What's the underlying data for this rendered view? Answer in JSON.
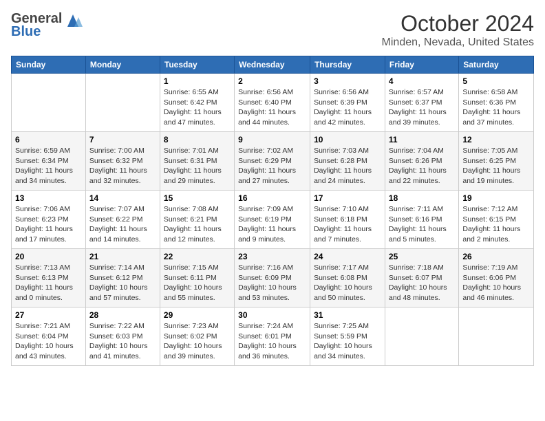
{
  "header": {
    "logo_text_general": "General",
    "logo_text_blue": "Blue",
    "title": "October 2024",
    "subtitle": "Minden, Nevada, United States"
  },
  "days_of_week": [
    "Sunday",
    "Monday",
    "Tuesday",
    "Wednesday",
    "Thursday",
    "Friday",
    "Saturday"
  ],
  "weeks": [
    [
      {
        "num": "",
        "sunrise": "",
        "sunset": "",
        "daylight": ""
      },
      {
        "num": "",
        "sunrise": "",
        "sunset": "",
        "daylight": ""
      },
      {
        "num": "1",
        "sunrise": "Sunrise: 6:55 AM",
        "sunset": "Sunset: 6:42 PM",
        "daylight": "Daylight: 11 hours and 47 minutes."
      },
      {
        "num": "2",
        "sunrise": "Sunrise: 6:56 AM",
        "sunset": "Sunset: 6:40 PM",
        "daylight": "Daylight: 11 hours and 44 minutes."
      },
      {
        "num": "3",
        "sunrise": "Sunrise: 6:56 AM",
        "sunset": "Sunset: 6:39 PM",
        "daylight": "Daylight: 11 hours and 42 minutes."
      },
      {
        "num": "4",
        "sunrise": "Sunrise: 6:57 AM",
        "sunset": "Sunset: 6:37 PM",
        "daylight": "Daylight: 11 hours and 39 minutes."
      },
      {
        "num": "5",
        "sunrise": "Sunrise: 6:58 AM",
        "sunset": "Sunset: 6:36 PM",
        "daylight": "Daylight: 11 hours and 37 minutes."
      }
    ],
    [
      {
        "num": "6",
        "sunrise": "Sunrise: 6:59 AM",
        "sunset": "Sunset: 6:34 PM",
        "daylight": "Daylight: 11 hours and 34 minutes."
      },
      {
        "num": "7",
        "sunrise": "Sunrise: 7:00 AM",
        "sunset": "Sunset: 6:32 PM",
        "daylight": "Daylight: 11 hours and 32 minutes."
      },
      {
        "num": "8",
        "sunrise": "Sunrise: 7:01 AM",
        "sunset": "Sunset: 6:31 PM",
        "daylight": "Daylight: 11 hours and 29 minutes."
      },
      {
        "num": "9",
        "sunrise": "Sunrise: 7:02 AM",
        "sunset": "Sunset: 6:29 PM",
        "daylight": "Daylight: 11 hours and 27 minutes."
      },
      {
        "num": "10",
        "sunrise": "Sunrise: 7:03 AM",
        "sunset": "Sunset: 6:28 PM",
        "daylight": "Daylight: 11 hours and 24 minutes."
      },
      {
        "num": "11",
        "sunrise": "Sunrise: 7:04 AM",
        "sunset": "Sunset: 6:26 PM",
        "daylight": "Daylight: 11 hours and 22 minutes."
      },
      {
        "num": "12",
        "sunrise": "Sunrise: 7:05 AM",
        "sunset": "Sunset: 6:25 PM",
        "daylight": "Daylight: 11 hours and 19 minutes."
      }
    ],
    [
      {
        "num": "13",
        "sunrise": "Sunrise: 7:06 AM",
        "sunset": "Sunset: 6:23 PM",
        "daylight": "Daylight: 11 hours and 17 minutes."
      },
      {
        "num": "14",
        "sunrise": "Sunrise: 7:07 AM",
        "sunset": "Sunset: 6:22 PM",
        "daylight": "Daylight: 11 hours and 14 minutes."
      },
      {
        "num": "15",
        "sunrise": "Sunrise: 7:08 AM",
        "sunset": "Sunset: 6:21 PM",
        "daylight": "Daylight: 11 hours and 12 minutes."
      },
      {
        "num": "16",
        "sunrise": "Sunrise: 7:09 AM",
        "sunset": "Sunset: 6:19 PM",
        "daylight": "Daylight: 11 hours and 9 minutes."
      },
      {
        "num": "17",
        "sunrise": "Sunrise: 7:10 AM",
        "sunset": "Sunset: 6:18 PM",
        "daylight": "Daylight: 11 hours and 7 minutes."
      },
      {
        "num": "18",
        "sunrise": "Sunrise: 7:11 AM",
        "sunset": "Sunset: 6:16 PM",
        "daylight": "Daylight: 11 hours and 5 minutes."
      },
      {
        "num": "19",
        "sunrise": "Sunrise: 7:12 AM",
        "sunset": "Sunset: 6:15 PM",
        "daylight": "Daylight: 11 hours and 2 minutes."
      }
    ],
    [
      {
        "num": "20",
        "sunrise": "Sunrise: 7:13 AM",
        "sunset": "Sunset: 6:13 PM",
        "daylight": "Daylight: 11 hours and 0 minutes."
      },
      {
        "num": "21",
        "sunrise": "Sunrise: 7:14 AM",
        "sunset": "Sunset: 6:12 PM",
        "daylight": "Daylight: 10 hours and 57 minutes."
      },
      {
        "num": "22",
        "sunrise": "Sunrise: 7:15 AM",
        "sunset": "Sunset: 6:11 PM",
        "daylight": "Daylight: 10 hours and 55 minutes."
      },
      {
        "num": "23",
        "sunrise": "Sunrise: 7:16 AM",
        "sunset": "Sunset: 6:09 PM",
        "daylight": "Daylight: 10 hours and 53 minutes."
      },
      {
        "num": "24",
        "sunrise": "Sunrise: 7:17 AM",
        "sunset": "Sunset: 6:08 PM",
        "daylight": "Daylight: 10 hours and 50 minutes."
      },
      {
        "num": "25",
        "sunrise": "Sunrise: 7:18 AM",
        "sunset": "Sunset: 6:07 PM",
        "daylight": "Daylight: 10 hours and 48 minutes."
      },
      {
        "num": "26",
        "sunrise": "Sunrise: 7:19 AM",
        "sunset": "Sunset: 6:06 PM",
        "daylight": "Daylight: 10 hours and 46 minutes."
      }
    ],
    [
      {
        "num": "27",
        "sunrise": "Sunrise: 7:21 AM",
        "sunset": "Sunset: 6:04 PM",
        "daylight": "Daylight: 10 hours and 43 minutes."
      },
      {
        "num": "28",
        "sunrise": "Sunrise: 7:22 AM",
        "sunset": "Sunset: 6:03 PM",
        "daylight": "Daylight: 10 hours and 41 minutes."
      },
      {
        "num": "29",
        "sunrise": "Sunrise: 7:23 AM",
        "sunset": "Sunset: 6:02 PM",
        "daylight": "Daylight: 10 hours and 39 minutes."
      },
      {
        "num": "30",
        "sunrise": "Sunrise: 7:24 AM",
        "sunset": "Sunset: 6:01 PM",
        "daylight": "Daylight: 10 hours and 36 minutes."
      },
      {
        "num": "31",
        "sunrise": "Sunrise: 7:25 AM",
        "sunset": "Sunset: 5:59 PM",
        "daylight": "Daylight: 10 hours and 34 minutes."
      },
      {
        "num": "",
        "sunrise": "",
        "sunset": "",
        "daylight": ""
      },
      {
        "num": "",
        "sunrise": "",
        "sunset": "",
        "daylight": ""
      }
    ]
  ]
}
